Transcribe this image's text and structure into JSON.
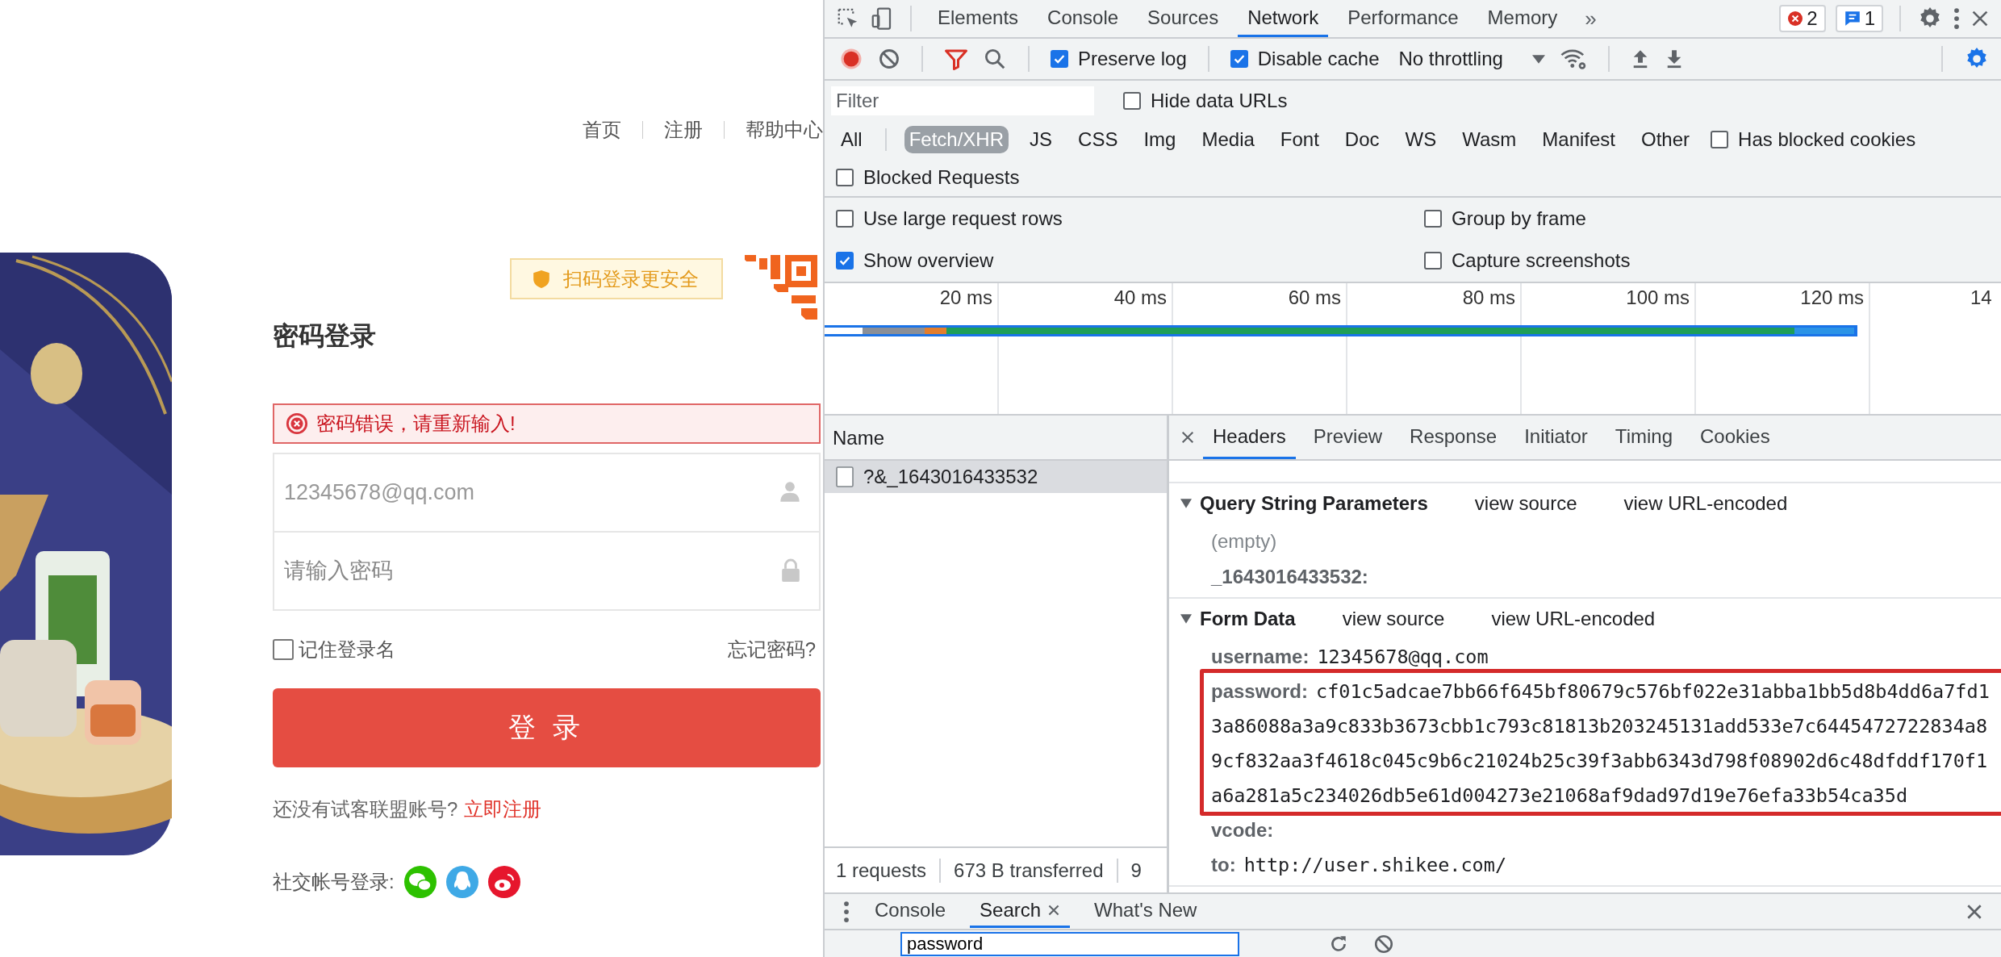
{
  "login_page": {
    "nav_links": [
      "首页",
      "注册",
      "帮助中心"
    ],
    "qr_hint": "扫码登录更安全",
    "title": "密码登录",
    "error_message": "密码错误，请重新输入!",
    "username_field": {
      "value": "12345678@qq.com"
    },
    "password_field": {
      "placeholder": "请输入密码"
    },
    "remember": {
      "label": "记住登录名",
      "checked": false
    },
    "forgot_link": "忘记密码?",
    "login_button": "登 录",
    "register_prompt": "还没有试客联盟账号?",
    "register_link": "立即注册",
    "social_label": "社交帐号登录:"
  },
  "devtools": {
    "tabs": [
      {
        "label": "Elements",
        "selected": false
      },
      {
        "label": "Console",
        "selected": false
      },
      {
        "label": "Sources",
        "selected": false
      },
      {
        "label": "Network",
        "selected": true
      },
      {
        "label": "Performance",
        "selected": false
      },
      {
        "label": "Memory",
        "selected": false
      }
    ],
    "more_tabs": "»",
    "error_count": "2",
    "message_count": "1",
    "toolbar": {
      "recording": true,
      "preserve_log": {
        "label": "Preserve log",
        "checked": true
      },
      "disable_cache": {
        "label": "Disable cache",
        "checked": true
      },
      "throttling": "No throttling"
    },
    "filter": {
      "placeholder": "Filter"
    },
    "hide_data_urls": {
      "label": "Hide data URLs",
      "checked": false
    },
    "type_filters": [
      {
        "label": "All",
        "selected": false
      },
      {
        "label": "Fetch/XHR",
        "selected": true
      },
      {
        "label": "JS",
        "selected": false
      },
      {
        "label": "CSS",
        "selected": false
      },
      {
        "label": "Img",
        "selected": false
      },
      {
        "label": "Media",
        "selected": false
      },
      {
        "label": "Font",
        "selected": false
      },
      {
        "label": "Doc",
        "selected": false
      },
      {
        "label": "WS",
        "selected": false
      },
      {
        "label": "Wasm",
        "selected": false
      },
      {
        "label": "Manifest",
        "selected": false
      },
      {
        "label": "Other",
        "selected": false
      }
    ],
    "has_blocked_cookies": {
      "label": "Has blocked cookies",
      "checked": false
    },
    "blocked_requests": {
      "label": "Blocked Requests",
      "checked": false
    },
    "settings": [
      {
        "label": "Use large request rows",
        "checked": false
      },
      {
        "label": "Group by frame",
        "checked": false
      },
      {
        "label": "Show overview",
        "checked": true
      },
      {
        "label": "Capture screenshots",
        "checked": false
      }
    ],
    "overview_ticks": [
      "20 ms",
      "40 ms",
      "60 ms",
      "80 ms",
      "100 ms",
      "120 ms",
      "14"
    ],
    "requests": {
      "column": "Name",
      "rows": [
        {
          "name": "?&_1643016433532",
          "selected": true
        }
      ]
    },
    "detail_tabs": [
      {
        "label": "Headers",
        "selected": true
      },
      {
        "label": "Preview",
        "selected": false
      },
      {
        "label": "Response",
        "selected": false
      },
      {
        "label": "Initiator",
        "selected": false
      },
      {
        "label": "Timing",
        "selected": false
      },
      {
        "label": "Cookies",
        "selected": false
      }
    ],
    "sections": [
      {
        "title": "Query String Parameters",
        "expanded": true,
        "links": [
          "view source",
          "view URL-encoded"
        ],
        "note": "(empty)",
        "params": [
          {
            "key": "_1643016433532:"
          }
        ]
      },
      {
        "title": "Form Data",
        "expanded": true,
        "links": [
          "view source",
          "view URL-encoded"
        ],
        "params": [
          {
            "key": "username:",
            "value_lines": [
              "12345678@qq.com"
            ],
            "highlighted": false
          },
          {
            "key": "password:",
            "value_lines": [
              "cf01c5adcae7bb66f645bf80679c576bf022e31abba1bb5d8b4dd6a7fd1",
              "3a86088a3a9c833b3673cbb1c793c81813b203245131add533e7c6445472722834a8",
              "9cf832aa3f4618c045c9b6c21024b25c39f3abb6343d798f08902d6c48dfddf170f1",
              "a6a281a5c234026db5e61d004273e21068af9dad97d19e76efa33b54ca35d"
            ],
            "highlighted": true
          },
          {
            "key": "vcode:",
            "highlighted": false
          },
          {
            "key": "to:",
            "value_lines": [
              "http://user.shikee.com/"
            ],
            "highlighted": false
          }
        ]
      }
    ],
    "status_bar": [
      "1 requests",
      "673 B transferred",
      "9"
    ],
    "drawer_tabs": [
      {
        "label": "Console",
        "selected": false,
        "closable": false
      },
      {
        "label": "Search",
        "selected": true,
        "closable": true
      },
      {
        "label": "What's New",
        "selected": false,
        "closable": false
      }
    ],
    "search": {
      "value": "password"
    }
  }
}
